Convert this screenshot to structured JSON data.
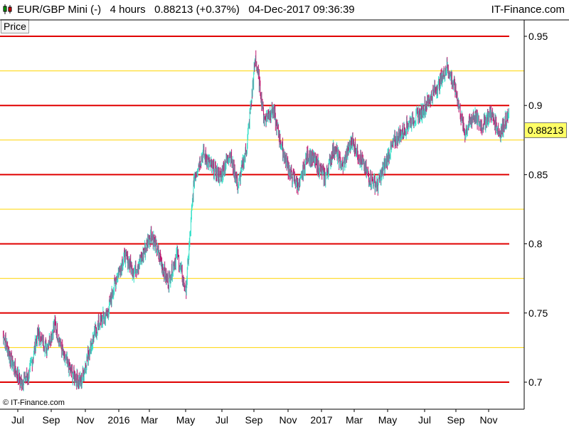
{
  "header": {
    "symbol": "EUR/GBP Mini (-)",
    "timeframe": "4 hours",
    "last": "0.88213",
    "change": "(+0.37%)",
    "datetime": "04-Dec-2017 09:36:39",
    "brand": "IT-Finance.com"
  },
  "toolbar": {
    "price_label": "Price"
  },
  "footer": {
    "copyright": "© IT-Finance.com"
  },
  "colors": {
    "up": "#33e0c8",
    "down": "#c0166e",
    "major_line": "#e00000",
    "minor_line": "#ffd400"
  },
  "chart_data": {
    "type": "line",
    "title": "EUR/GBP Mini (-)",
    "ylim": [
      0.694,
      0.958
    ],
    "y_ticks": [
      0.7,
      0.75,
      0.8,
      0.85,
      0.9,
      0.95
    ],
    "y_tick_labels": [
      "0.7",
      "0.75",
      "0.8",
      "0.85",
      "0.9",
      "0.95"
    ],
    "major_levels": [
      0.7,
      0.75,
      0.8,
      0.85,
      0.9,
      0.95
    ],
    "minor_levels": [
      0.725,
      0.775,
      0.825,
      0.875,
      0.925
    ],
    "x_tick_labels": [
      "Jul",
      "Sep",
      "Nov",
      "2016",
      "Mar",
      "May",
      "Jul",
      "Sep",
      "Nov",
      "2017",
      "Mar",
      "May",
      "Jul",
      "Sep",
      "Nov"
    ],
    "last_value": 0.88213,
    "last_value_label": "0.88213",
    "series": [
      {
        "x_month_index": [
          0,
          0.5,
          1,
          1.5,
          2,
          2.5,
          3,
          3.5,
          4,
          4.5,
          5,
          5.5,
          6,
          6.5,
          7,
          7.5,
          8,
          8.5,
          9,
          9.5,
          10,
          10.5,
          11,
          11.5,
          12,
          12.5,
          13,
          13.5,
          14,
          14.5,
          15,
          15.5,
          16,
          16.5,
          17,
          17.5,
          18,
          18.5,
          19,
          19.5,
          20,
          20.5,
          21,
          21.5,
          22,
          22.5,
          23,
          23.5,
          24,
          24.5,
          25,
          25.5,
          26,
          26.5,
          27,
          27.5,
          28,
          28.5,
          29,
          29.5
        ],
        "values": [
          0.735,
          0.715,
          0.7,
          0.705,
          0.735,
          0.725,
          0.742,
          0.718,
          0.705,
          0.7,
          0.725,
          0.742,
          0.75,
          0.775,
          0.792,
          0.78,
          0.79,
          0.808,
          0.79,
          0.772,
          0.793,
          0.765,
          0.85,
          0.865,
          0.855,
          0.848,
          0.866,
          0.842,
          0.87,
          0.935,
          0.89,
          0.897,
          0.87,
          0.85,
          0.842,
          0.865,
          0.858,
          0.848,
          0.87,
          0.855,
          0.875,
          0.862,
          0.848,
          0.842,
          0.86,
          0.875,
          0.882,
          0.89,
          0.895,
          0.905,
          0.915,
          0.928,
          0.91,
          0.88,
          0.893,
          0.885,
          0.895,
          0.88,
          0.892,
          0.882
        ]
      }
    ]
  }
}
